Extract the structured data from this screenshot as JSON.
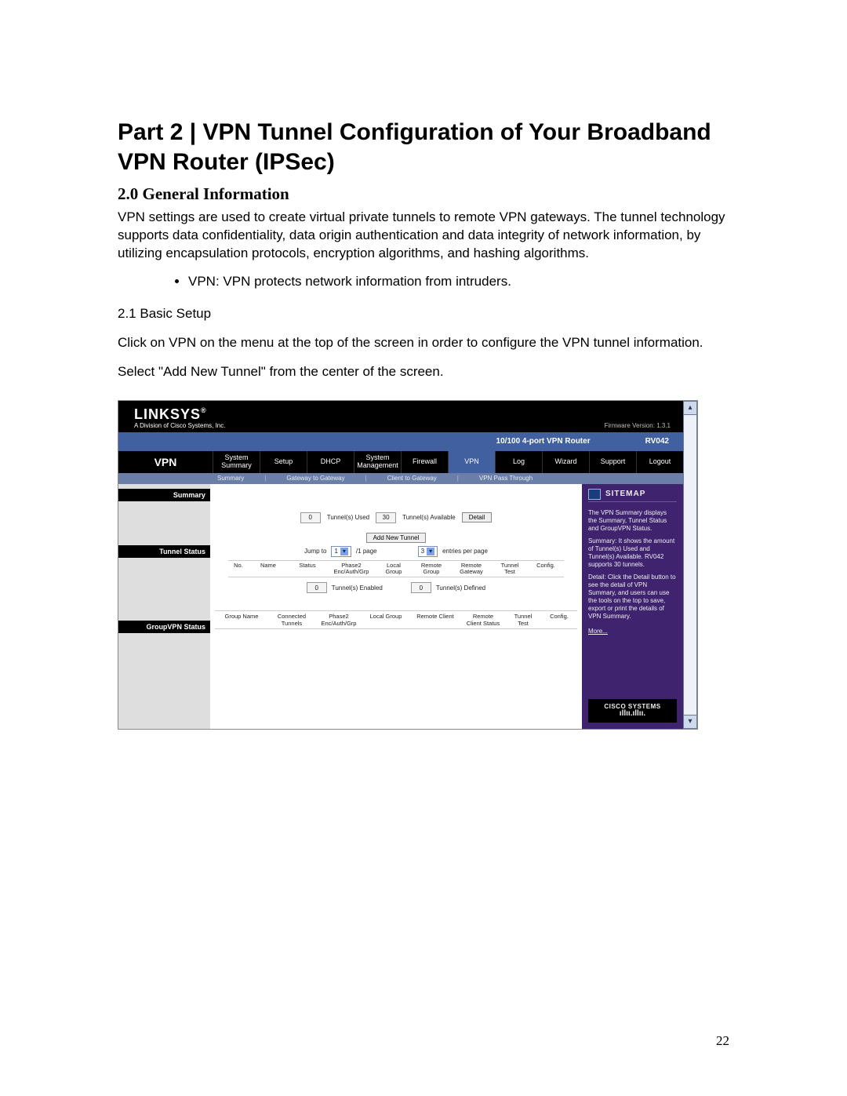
{
  "doc": {
    "title": "Part 2 | VPN Tunnel Configuration of Your Broadband VPN Router (IPSec)",
    "section_heading": "2.0 General Information",
    "intro": "VPN settings are used to create virtual private tunnels to remote VPN gateways. The tunnel technology supports data confidentiality, data origin authentication and data integrity of network information, by utilizing encapsulation protocols, encryption algorithms, and hashing algorithms.",
    "bullet_vpn": "VPN: VPN protects network information from intruders.",
    "subsection": "2.1 Basic Setup",
    "para1": "Click on VPN on the menu at the top of the screen in order to configure the VPN tunnel information.",
    "para2": "Select \"Add New Tunnel\" from the center of the screen.",
    "page_number": "22"
  },
  "ui": {
    "brand": {
      "logo": "LINKSYS",
      "reg": "®",
      "sub": "A Division of Cisco Systems, Inc."
    },
    "firmware": "Firmware Version: 1.3.1",
    "product_name": "10/100 4-port VPN Router",
    "model": "RV042",
    "nav_title": "VPN",
    "tabs": {
      "sys_summary": "System\nSummary",
      "setup": "Setup",
      "dhcp": "DHCP",
      "sys_mgmt": "System\nManagement",
      "firewall": "Firewall",
      "vpn": "VPN",
      "log": "Log",
      "wizard": "Wizard",
      "support": "Support",
      "logout": "Logout"
    },
    "subnav": {
      "summary": "Summary",
      "g2g": "Gateway to Gateway",
      "c2g": "Client to Gateway",
      "passthru": "VPN Pass Through"
    },
    "left": {
      "summary": "Summary",
      "tunnel_status": "Tunnel Status",
      "groupvpn_status": "GroupVPN Status"
    },
    "center": {
      "used_val": "0",
      "used_label": "Tunnel(s) Used",
      "avail_val": "30",
      "avail_label": "Tunnel(s) Available",
      "detail_btn": "Detail",
      "addnew_btn": "Add New Tunnel",
      "jump_prefix": "Jump to",
      "jump_val": "1",
      "jump_suffix": "/1 page",
      "entries_val": "3",
      "entries_suffix": "entries per page",
      "tbl1": {
        "c1": "No.",
        "c2": "Name",
        "c3": "Status",
        "c4": "Phase2\nEnc/Auth/Grp",
        "c5": "Local\nGroup",
        "c6": "Remote\nGroup",
        "c7": "Remote\nGateway",
        "c8": "Tunnel\nTest",
        "c9": "Config."
      },
      "enabled_val": "0",
      "enabled_label": "Tunnel(s) Enabled",
      "defined_val": "0",
      "defined_label": "Tunnel(s) Defined",
      "tbl2": {
        "c1": "Group Name",
        "c2": "Connected\nTunnels",
        "c3": "Phase2\nEnc/Auth/Grp",
        "c4": "Local Group",
        "c5": "Remote Client",
        "c6": "Remote\nClient Status",
        "c7": "Tunnel\nTest",
        "c8": "Config."
      }
    },
    "right": {
      "sitemap": "SITEMAP",
      "p1": "The VPN Summary displays the Summary, Tunnel Status and GroupVPN Status.",
      "p2": "Summary: It shows the amount of Tunnel(s) Used and Tunnel(s) Available. RV042 supports 30 tunnels.",
      "p3": "Detail: Click the Detail button to see the detail of VPN Summary, and users can use the tools on the top to save, export or print the details of VPN Summary.",
      "more": "More...",
      "cisco": "CISCO SYSTEMS"
    }
  }
}
